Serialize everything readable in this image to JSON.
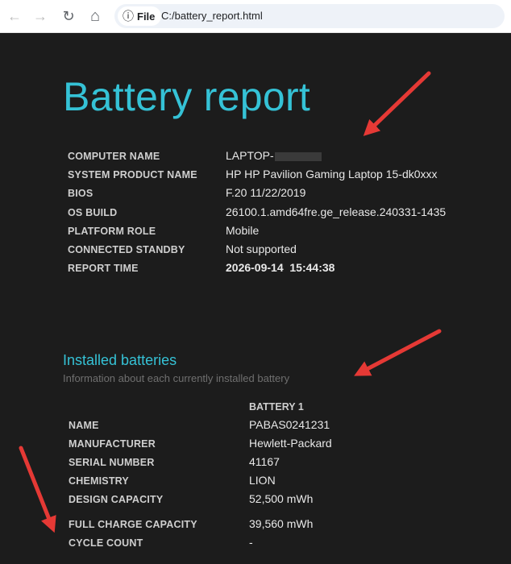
{
  "browser": {
    "back_icon": "←",
    "forward_icon": "→",
    "reload_icon": "↻",
    "home_icon": "⌂",
    "info_icon": "ⓘ",
    "file_label": "File",
    "url": "C:/battery_report.html"
  },
  "report": {
    "title": "Battery report",
    "system_info": [
      {
        "label": "COMPUTER NAME",
        "value": "LAPTOP-",
        "redacted": true
      },
      {
        "label": "SYSTEM PRODUCT NAME",
        "value": "HP HP Pavilion Gaming Laptop 15-dk0xxx"
      },
      {
        "label": "BIOS",
        "value": "F.20 11/22/2019"
      },
      {
        "label": "OS BUILD",
        "value": "26100.1.amd64fre.ge_release.240331-1435"
      },
      {
        "label": "PLATFORM ROLE",
        "value": "Mobile"
      },
      {
        "label": "CONNECTED STANDBY",
        "value": "Not supported"
      },
      {
        "label": "REPORT TIME",
        "value": "2026-09-14  15:44:38"
      }
    ]
  },
  "installed_batteries": {
    "title": "Installed batteries",
    "subtitle": "Information about each currently installed battery",
    "column_header": "BATTERY 1",
    "rows": [
      {
        "label": "NAME",
        "value": "PABAS0241231"
      },
      {
        "label": "MANUFACTURER",
        "value": "Hewlett-Packard"
      },
      {
        "label": "SERIAL NUMBER",
        "value": "41167"
      },
      {
        "label": "CHEMISTRY",
        "value": "LION"
      },
      {
        "label": "DESIGN CAPACITY",
        "value": "52,500 mWh"
      },
      {
        "label": "FULL CHARGE CAPACITY",
        "value": "39,560 mWh"
      },
      {
        "label": "CYCLE COUNT",
        "value": "-"
      }
    ]
  },
  "annotation_color": "#e53935"
}
